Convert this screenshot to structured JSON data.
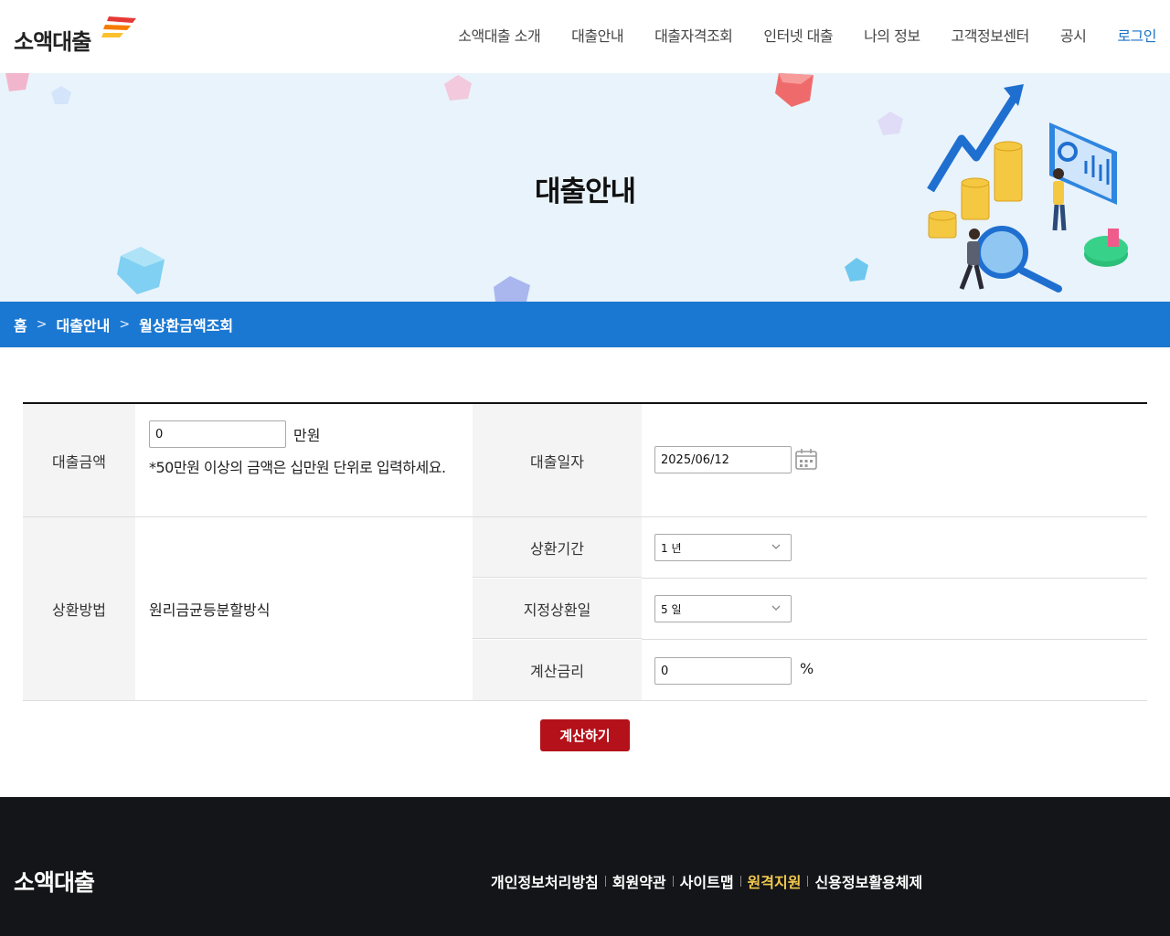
{
  "header": {
    "logo": "소액대출",
    "nav": [
      "소액대출 소개",
      "대출안내",
      "대출자격조회",
      "인터넷 대출",
      "나의 정보",
      "고객정보센터",
      "공시",
      "로그인"
    ]
  },
  "hero": {
    "title": "대출안내"
  },
  "breadcrumb": {
    "home": "홈",
    "level1": "대출안내",
    "level2": "월상환금액조회"
  },
  "form": {
    "loan_amount_label": "대출금액",
    "loan_amount_value": "0",
    "loan_amount_unit": "만원",
    "loan_amount_note": "*50만원 이상의 금액은 십만원 단위로 입력하세요.",
    "loan_date_label": "대출일자",
    "loan_date_value": "2025/06/12",
    "repay_method_label": "상환방법",
    "repay_method_value": "원리금균등분할방식",
    "repay_period_label": "상환기간",
    "repay_period_value": "1 년",
    "repay_day_label": "지정상환일",
    "repay_day_value": "5 일",
    "rate_label": "계산금리",
    "rate_value": "0",
    "rate_unit": "%",
    "submit_label": "계산하기"
  },
  "footer": {
    "logo": "소액대출",
    "links": [
      "개인정보처리방침",
      "회원약관",
      "사이트맵",
      "원격지원",
      "신용정보활용체제"
    ],
    "highlight_color": "#f2c94c"
  },
  "colors": {
    "accent_blue": "#1a78d2",
    "button_red": "#b4111a",
    "footer_bg": "#141519"
  }
}
